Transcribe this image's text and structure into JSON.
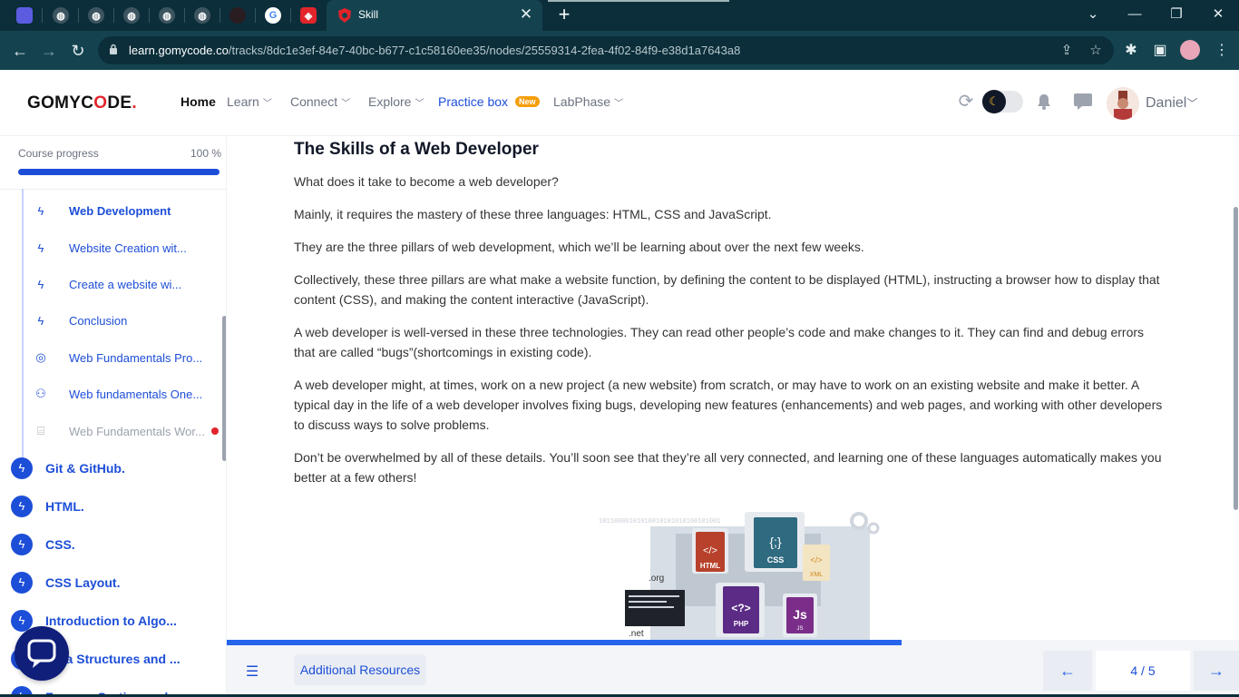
{
  "browser": {
    "active_tab_title": "Skill",
    "url_host": "learn.gomycode.co",
    "url_path": "/tracks/8dc1e3ef-84e7-40bc-b677-c1c58160ee35/nodes/25559314-2fea-4f02-84f9-e38d1a7643a8",
    "close_tab": "✕",
    "new_tab": "+",
    "window": {
      "minimize": "—",
      "restore": "❐",
      "close": "✕",
      "tabsearch": "⌄"
    }
  },
  "header": {
    "logo": {
      "part1": "GOMYC",
      "part2": "O",
      "part3": "DE",
      "reg": "."
    },
    "nav": {
      "home": "Home",
      "learn": "Learn",
      "connect": "Connect",
      "explore": "Explore",
      "practice": "Practice box",
      "practice_badge": "New",
      "labphase": "LabPhase"
    },
    "user_name": "Daniel"
  },
  "sidebar": {
    "progress_label": "Course progress",
    "progress_value": "100 %",
    "progress_fraction": 1.0,
    "sub_items": [
      {
        "label": "Web Development",
        "icon": "bolt-icon",
        "active": true
      },
      {
        "label": "Website Creation wit...",
        "icon": "bolt-icon"
      },
      {
        "label": "Create a website wi...",
        "icon": "bolt-icon"
      },
      {
        "label": "Conclusion",
        "icon": "bolt-icon"
      },
      {
        "label": "Web Fundamentals Pro...",
        "icon": "target-icon"
      },
      {
        "label": "Web fundamentals One...",
        "icon": "people-icon"
      },
      {
        "label": "Web Fundamentals Wor...",
        "icon": "workshop-icon",
        "dim": true
      }
    ],
    "modules": [
      "Git & GitHub.",
      "HTML.",
      "CSS.",
      "CSS Layout.",
      "Introduction to Algo...",
      "Data Structures and ...",
      "Famous Sorting and s..."
    ]
  },
  "article": {
    "title": "The Skills of a Web Developer",
    "paragraphs": [
      "What does it take to become a web developer?",
      "Mainly, it requires the mastery of these three languages: HTML, CSS and JavaScript.",
      "They are the three pillars of web development, which we’ll be learning about over the next few weeks.",
      "Collectively, these three pillars are what make a website function, by defining the content to be displayed (HTML), instructing a browser how to display that content (CSS), and making the content interactive (JavaScript).",
      "A web developer is well-versed in these three technologies. They can read other people’s code and make changes to it. They can find and debug errors that are called “bugs”(shortcomings in existing code).",
      "A web developer might, at times, work on a new project (a new website) from scratch, or may have to work on an existing website and make it better. A typical day in the life of a web developer involves fixing bugs, developing new features (enhancements) and web pages, and working with other developers to discuss ways to solve problems.",
      "Don’t be overwhelmed by all of these details. You’ll soon see that they’re all very connected, and learning one of these languages automatically makes you better at a few others!"
    ],
    "figure_labels": {
      "html": "HTML",
      "css": "CSS",
      "xml": "XML",
      "php": "PHP",
      "js": "JS",
      "js_big": "Js",
      "org": ".org",
      "net": ".net",
      "php_sym": "<?>",
      "css_sym": "{;}",
      "html_sym": "</>",
      "xml_sym": "</>",
      "binary": "10110000101010010101010100101001"
    }
  },
  "footer": {
    "resources_label": "Additional Resources",
    "page_indicator": "4 / 5",
    "lesson_progress_fraction": 0.667,
    "prev": "←",
    "next": "→",
    "menu_icon": "☰"
  },
  "colors": {
    "brand_blue": "#1d4ed8",
    "accent_red": "#e3242b",
    "browser_dark": "#0b2e3a",
    "browser_tab": "#14434f"
  }
}
